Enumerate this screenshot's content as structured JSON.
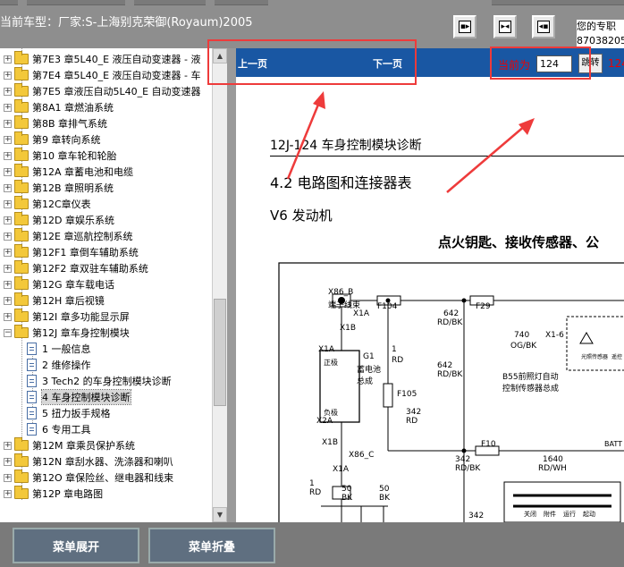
{
  "header": {
    "vehicle_text": "当前车型：厂家:S-上海别克荣御(Royaum)2005",
    "right_info_line1": "您的专职",
    "right_info_line2": "87038205"
  },
  "nav_buttons": [
    {
      "name": "first-page-icon",
      "glyph": "◂▪"
    },
    {
      "name": "fit-page-icon",
      "glyph": "▸◂"
    },
    {
      "name": "last-page-icon",
      "glyph": "▪▸"
    }
  ],
  "tree": {
    "items": [
      {
        "label": "第7E3 章5L40_E 液压自动变速器 - 液",
        "type": "folder",
        "exp": "+",
        "indent": 0
      },
      {
        "label": "第7E4 章5L40_E 液压自动变速器 - 车",
        "type": "folder",
        "exp": "+",
        "indent": 0
      },
      {
        "label": "第7E5 章液压自动5L40_E 自动变速器",
        "type": "folder",
        "exp": "+",
        "indent": 0
      },
      {
        "label": "第8A1 章燃油系统",
        "type": "folder",
        "exp": "+",
        "indent": 0
      },
      {
        "label": "第8B 章排气系统",
        "type": "folder",
        "exp": "+",
        "indent": 0
      },
      {
        "label": "第9 章转向系统",
        "type": "folder",
        "exp": "+",
        "indent": 0
      },
      {
        "label": "第10 章车轮和轮胎",
        "type": "folder",
        "exp": "+",
        "indent": 0
      },
      {
        "label": "第12A 章蓄电池和电缆",
        "type": "folder",
        "exp": "+",
        "indent": 0
      },
      {
        "label": "第12B 章照明系统",
        "type": "folder",
        "exp": "+",
        "indent": 0
      },
      {
        "label": "第12C章仪表",
        "type": "folder",
        "exp": "+",
        "indent": 0
      },
      {
        "label": "第12D 章娱乐系统",
        "type": "folder",
        "exp": "+",
        "indent": 0
      },
      {
        "label": "第12E 章巡航控制系统",
        "type": "folder",
        "exp": "+",
        "indent": 0
      },
      {
        "label": "第12F1 章倒车辅助系统",
        "type": "folder",
        "exp": "+",
        "indent": 0
      },
      {
        "label": "第12F2 章双驻车辅助系统",
        "type": "folder",
        "exp": "+",
        "indent": 0
      },
      {
        "label": "第12G 章车载电话",
        "type": "folder",
        "exp": "+",
        "indent": 0
      },
      {
        "label": "第12H 章后视镜",
        "type": "folder",
        "exp": "+",
        "indent": 0
      },
      {
        "label": "第12I 章多功能显示屏",
        "type": "folder",
        "exp": "+",
        "indent": 0
      },
      {
        "label": "第12J 章车身控制模块",
        "type": "folder",
        "exp": "−",
        "indent": 0
      },
      {
        "label": "1 一般信息",
        "type": "doc",
        "exp": "",
        "indent": 1
      },
      {
        "label": "2 维修操作",
        "type": "doc",
        "exp": "",
        "indent": 1
      },
      {
        "label": "3 Tech2 的车身控制模块诊断",
        "type": "doc",
        "exp": "",
        "indent": 1
      },
      {
        "label": "4 车身控制模块诊断",
        "type": "doc",
        "exp": "",
        "indent": 1,
        "selected": true
      },
      {
        "label": "5 扭力扳手规格",
        "type": "doc",
        "exp": "",
        "indent": 1
      },
      {
        "label": "6 专用工具",
        "type": "doc",
        "exp": "",
        "indent": 1
      },
      {
        "label": "第12M 章乘员保护系统",
        "type": "folder",
        "exp": "+",
        "indent": 0
      },
      {
        "label": "第12N 章刮水器、洗涤器和喇叭",
        "type": "folder",
        "exp": "+",
        "indent": 0
      },
      {
        "label": "第12O 章保险丝、继电器和线束",
        "type": "folder",
        "exp": "+",
        "indent": 0
      },
      {
        "label": "第12P 章电路图",
        "type": "folder",
        "exp": "+",
        "indent": 0
      }
    ]
  },
  "viewer": {
    "prev_label": "上一页",
    "next_label": "下一页",
    "current_label": "当前为",
    "page_value": "124",
    "jump_label": "跳转",
    "page_suffix": "124"
  },
  "document": {
    "header_code": "12J-124  车身控制模块诊断",
    "section": "4.2     电路图和连接器表",
    "engine": "V6 发动机",
    "diagram_title": "点火钥匙、接收传感器、公",
    "labels": {
      "x86b": "X86_B",
      "x86b_desc": "端子线束",
      "x1a": "X1A",
      "x1b": "X1B",
      "f104": "F104",
      "f29": "F29",
      "w642": "642",
      "rdbk": "RD/BK",
      "w740": "740",
      "ogbk": "OG/BK",
      "x16": "X1-6",
      "g1": "G1",
      "battery": "蓄电池总成",
      "pos": "正极",
      "neg": "负极",
      "f105": "F105",
      "w1": "1",
      "rd": "RD",
      "w342": "342",
      "f10": "F10",
      "w1640": "1640",
      "rdwh": "RD/WH",
      "b55": "B55前照灯自动控制传感器总成",
      "light_sensor": "光照传感器",
      "remote": "遥控",
      "x2a": "X2A",
      "x86c": "X86_C",
      "w50": "50",
      "bk": "BK",
      "batt": "BATT",
      "off": "关闭",
      "acc": "附件",
      "run": "运行",
      "start": "起动"
    }
  },
  "footer": {
    "expand_label": "菜单展开",
    "collapse_label": "菜单折叠"
  },
  "colors": {
    "nav_strip": "#1957a3",
    "annotation_red": "#ee3b3b",
    "folder": "#f3c83a"
  }
}
